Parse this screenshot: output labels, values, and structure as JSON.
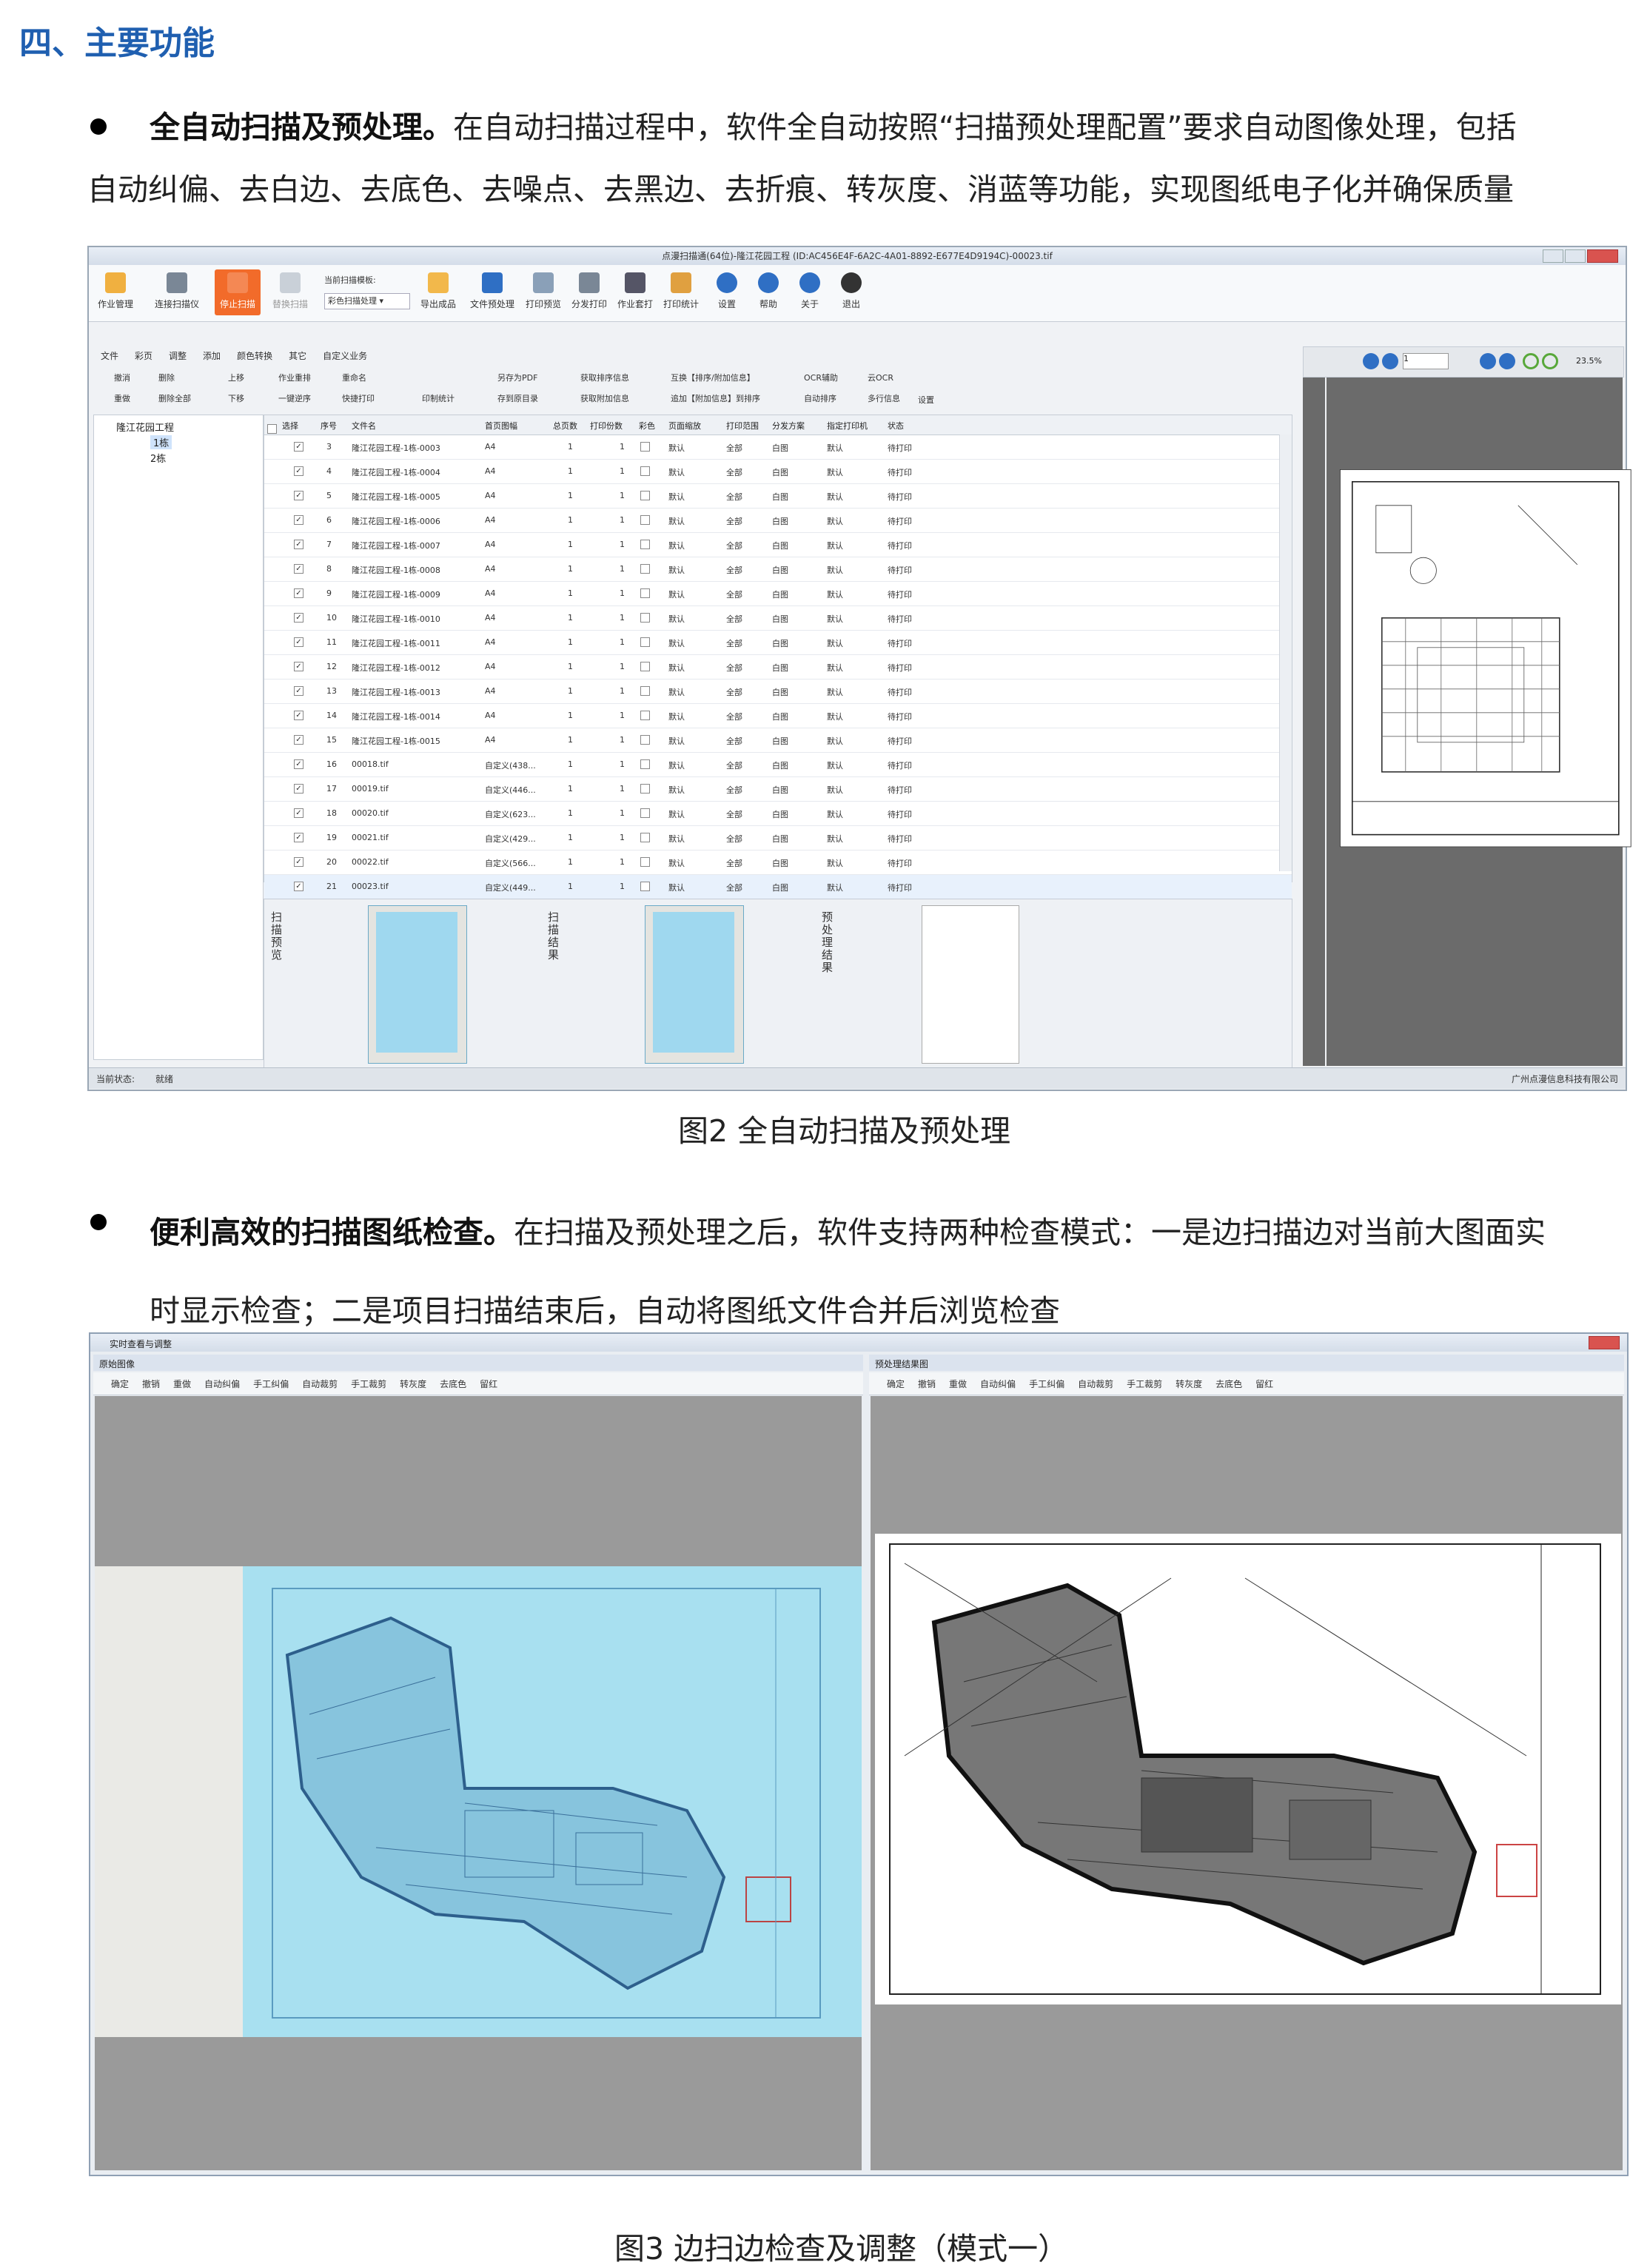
{
  "section": {
    "title": "四、主要功能"
  },
  "bullet1": {
    "bold": "全自动扫描及预处理。",
    "text_line1": "在自动扫描过程中，软件全自动按照“扫描预处理配置”要求自动图像处理，包括",
    "text_line2": "自动纠偏、去白边、去底色、去噪点、去黑边、去折痕、转灰度、消蓝等功能，实现图纸电子化并确保质量"
  },
  "fig2": {
    "caption": "图2  全自动扫描及预处理",
    "window_title": "点漫扫描通(64位)-隆江花园工程 (ID:AC456E4F-6A2C-4A01-8892-E677E4D9194C)-00023.tif",
    "ribbon_buttons": [
      "作业管理",
      "连接扫描仪",
      "停止扫描",
      "替换扫描",
      "当前扫描模板:",
      "彩色扫描处理",
      "导出成品",
      "文件预处理",
      "打印预览",
      "分发打印",
      "作业套打",
      "打印统计",
      "设置",
      "帮助",
      "关于",
      "退出"
    ],
    "tabs": [
      "文件",
      "彩页",
      "调整",
      "添加",
      "颜色转换",
      "其它",
      "自定义业务"
    ],
    "tools": [
      "撤消",
      "删除",
      "上移",
      "作业重排",
      "重命名",
      "另存为PDF",
      "获取排序信息",
      "互换【排序/附加信息】",
      "OCR辅助",
      "云OCR",
      "设置",
      "重做",
      "删除全部",
      "下移",
      "一键逆序",
      "快捷打印",
      "印制统计",
      "存到原目录",
      "获取附加信息",
      "追加【附加信息】到排序",
      "自动排序",
      "多行信息"
    ],
    "tree": {
      "root": "隆江花园工程",
      "children": [
        "1栋",
        "2栋"
      ]
    },
    "columns": [
      "选择",
      "序号",
      "文件名",
      "首页图幅",
      "总页数",
      "打印份数",
      "彩色",
      "页面缩放",
      "打印范围",
      "分发方案",
      "指定打印机",
      "状态"
    ],
    "rows": [
      {
        "n": "3",
        "name": "隆江花园工程-1栋-0003",
        "size": "A4"
      },
      {
        "n": "4",
        "name": "隆江花园工程-1栋-0004",
        "size": "A4"
      },
      {
        "n": "5",
        "name": "隆江花园工程-1栋-0005",
        "size": "A4"
      },
      {
        "n": "6",
        "name": "隆江花园工程-1栋-0006",
        "size": "A4"
      },
      {
        "n": "7",
        "name": "隆江花园工程-1栋-0007",
        "size": "A4"
      },
      {
        "n": "8",
        "name": "隆江花园工程-1栋-0008",
        "size": "A4"
      },
      {
        "n": "9",
        "name": "隆江花园工程-1栋-0009",
        "size": "A4"
      },
      {
        "n": "10",
        "name": "隆江花园工程-1栋-0010",
        "size": "A4"
      },
      {
        "n": "11",
        "name": "隆江花园工程-1栋-0011",
        "size": "A4"
      },
      {
        "n": "12",
        "name": "隆江花园工程-1栋-0012",
        "size": "A4"
      },
      {
        "n": "13",
        "name": "隆江花园工程-1栋-0013",
        "size": "A4"
      },
      {
        "n": "14",
        "name": "隆江花园工程-1栋-0014",
        "size": "A4"
      },
      {
        "n": "15",
        "name": "隆江花园工程-1栋-0015",
        "size": "A4"
      },
      {
        "n": "16",
        "name": "00018.tif",
        "size": "自定义(438..."
      },
      {
        "n": "17",
        "name": "00019.tif",
        "size": "自定义(446..."
      },
      {
        "n": "18",
        "name": "00020.tif",
        "size": "自定义(623..."
      },
      {
        "n": "19",
        "name": "00021.tif",
        "size": "自定义(429..."
      },
      {
        "n": "20",
        "name": "00022.tif",
        "size": "自定义(566..."
      },
      {
        "n": "21",
        "name": "00023.tif",
        "size": "自定义(449..."
      }
    ],
    "row_common": {
      "pages": "1",
      "copies": "1",
      "scale": "默认",
      "range": "全部",
      "scheme": "白图",
      "printer": "默认",
      "status": "待打印"
    },
    "thumb_labels": [
      "扫描预览",
      "扫描结果",
      "预处理结果"
    ],
    "zoom": "23.5%",
    "page_input": "1",
    "status_label": "当前状态:",
    "status_value": "就绪",
    "company": "广州点漫信息科技有限公司"
  },
  "bullet2": {
    "bold": "便利高效的扫描图纸检查。",
    "text_line1": "在扫描及预处理之后，软件支持两种检查模式：一是边扫描边对当前大图面实",
    "text_line2": "时显示检查；二是项目扫描结束后，自动将图纸文件合并后浏览检查"
  },
  "fig3": {
    "caption": "图3  边扫边检查及调整（模式一）",
    "window_title": "实时查看与调整",
    "left_title": "原始图像",
    "right_title": "预处理结果图",
    "tools": [
      "确定",
      "撤销",
      "重做",
      "自动纠偏",
      "手工纠偏",
      "自动裁剪",
      "手工裁剪",
      "转灰度",
      "去底色",
      "留红"
    ]
  }
}
